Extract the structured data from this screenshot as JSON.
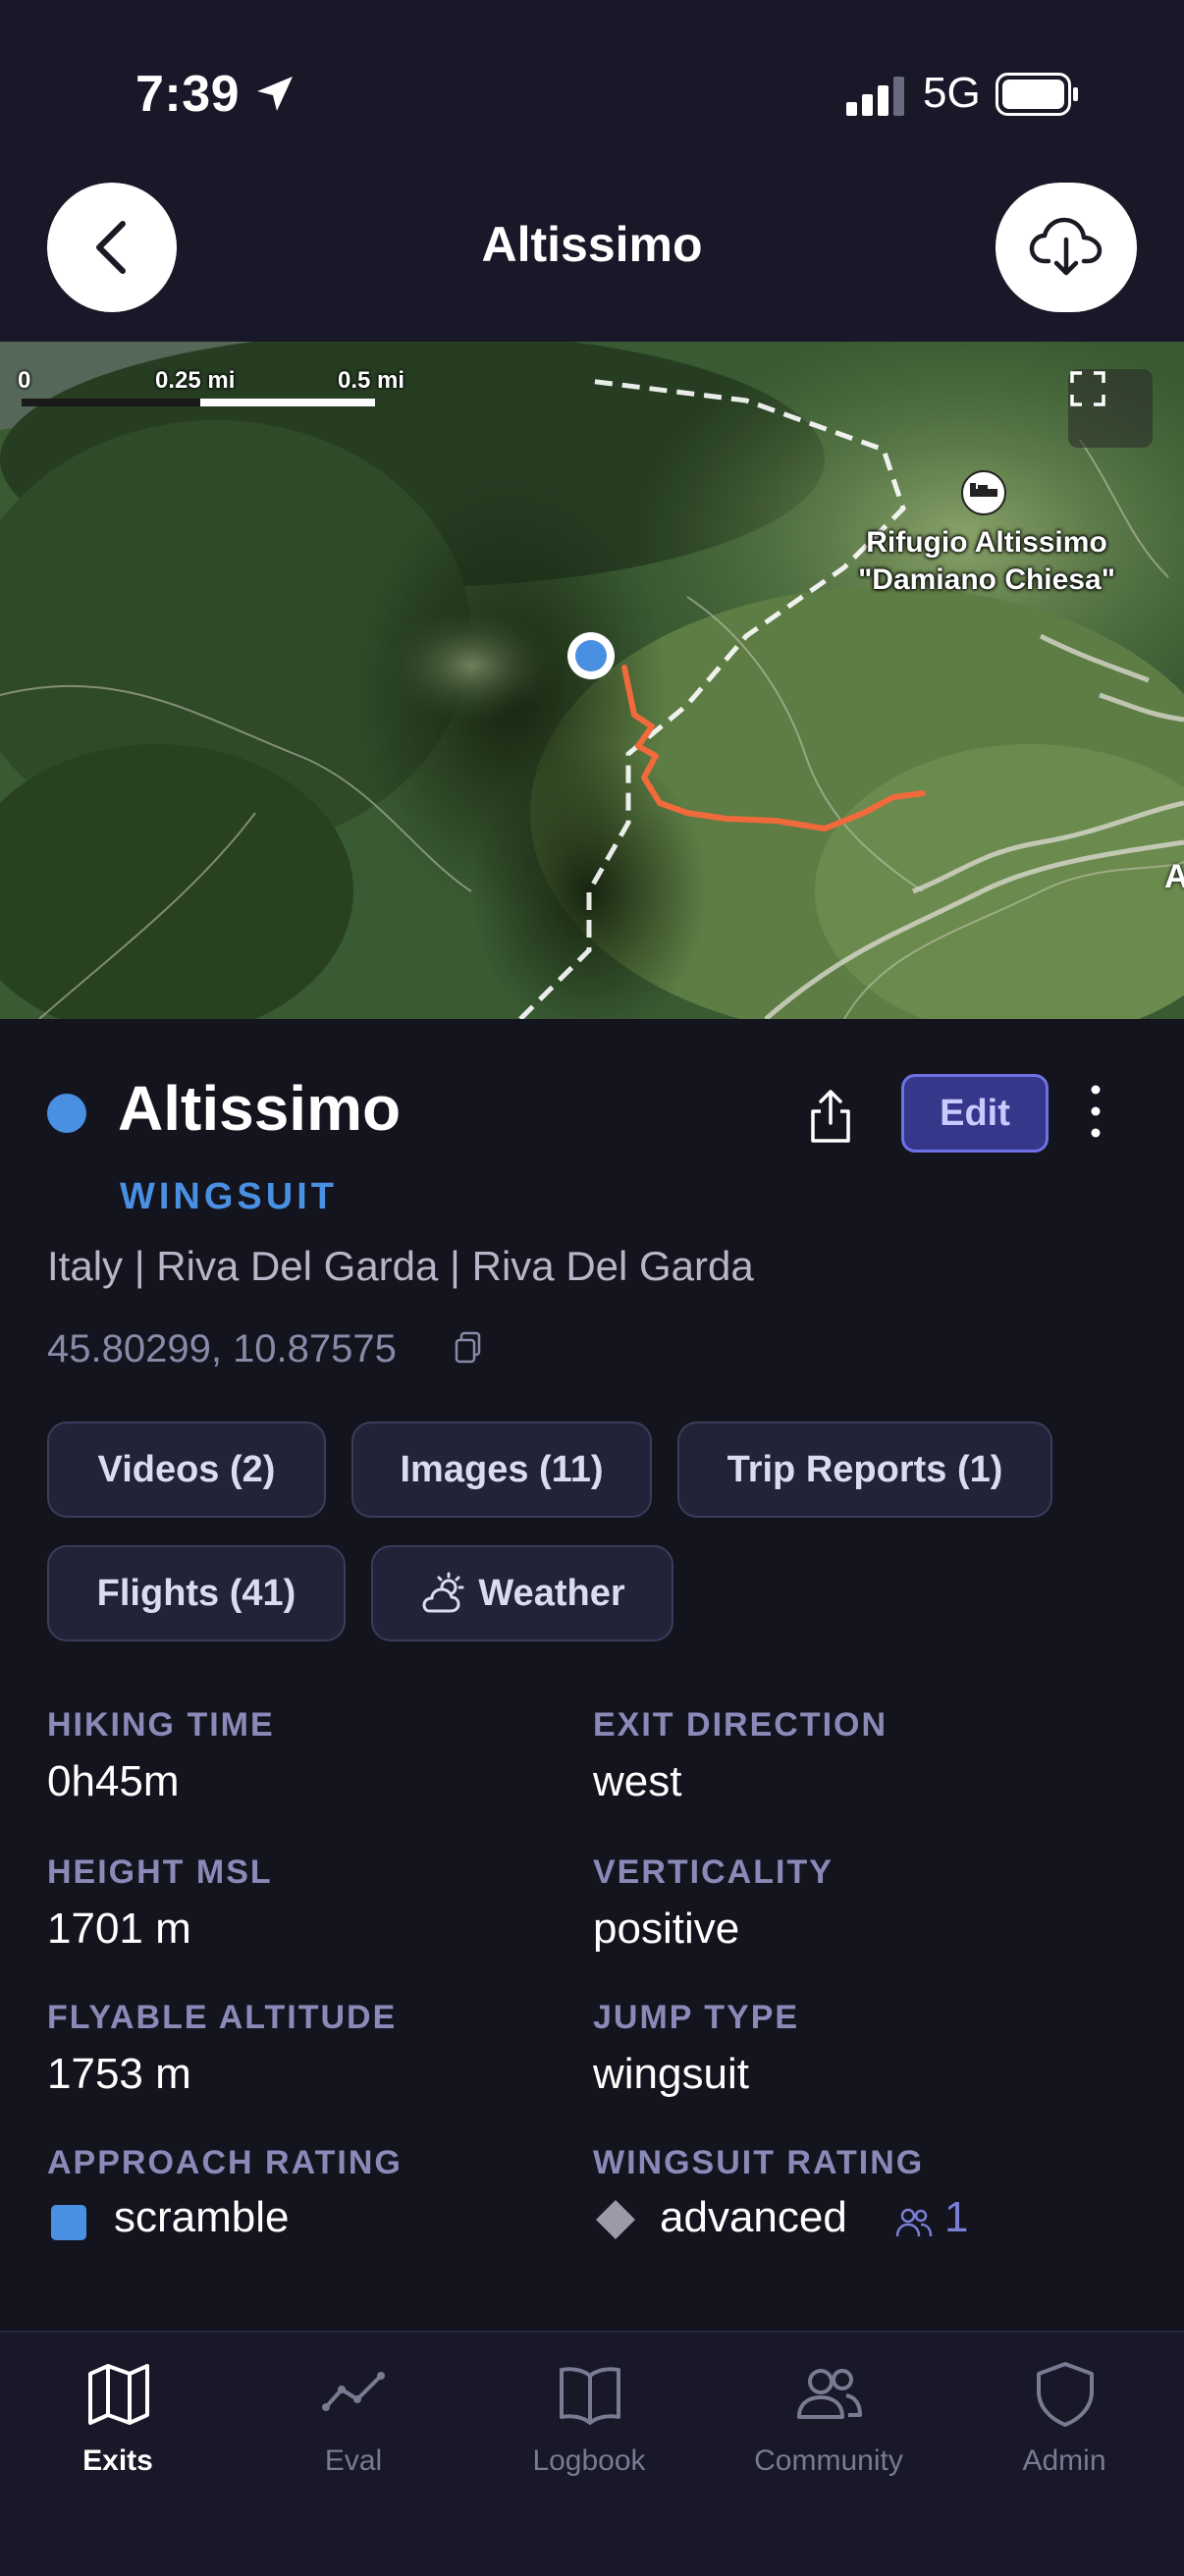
{
  "status_bar": {
    "time": "7:39",
    "network": "5G",
    "icons": [
      "location-arrow-icon",
      "signal-icon",
      "battery-icon"
    ]
  },
  "header": {
    "title": "Altissimo",
    "back_icon": "chevron-left-icon",
    "download_icon": "cloud-download-icon"
  },
  "map": {
    "scale_labels": [
      "0",
      "0.25 mi",
      "0.5 mi"
    ],
    "poi_label": "Rifugio Altissimo \"Damiano Chiesa\"",
    "poi_icon": "bed-icon",
    "edge_label": "A",
    "route_color": "#f06a3c",
    "trail_color": "#ffffff",
    "exit_marker_color": "#4a90e2",
    "fullscreen_icon": "fullscreen-icon"
  },
  "exit": {
    "name": "Altissimo",
    "category": "WINGSUIT",
    "location": "Italy | Riva Del Garda | Riva Del Garda",
    "coordinates": "45.80299, 10.87575",
    "edit_label": "Edit",
    "accent": "#4a90e2"
  },
  "chips": [
    {
      "label": "Videos (2)"
    },
    {
      "label": "Images (11)"
    },
    {
      "label": "Trip Reports (1)"
    },
    {
      "label": "Flights (41)"
    },
    {
      "label": "Weather",
      "icon": "sun-cloud-icon"
    }
  ],
  "stats": {
    "hiking_time": {
      "label": "HIKING TIME",
      "value": "0h45m"
    },
    "exit_direction": {
      "label": "EXIT DIRECTION",
      "value": "west"
    },
    "height_msl": {
      "label": "HEIGHT MSL",
      "value": "1701 m"
    },
    "verticality": {
      "label": "VERTICALITY",
      "value": "positive"
    },
    "flyable_altitude": {
      "label": "FLYABLE ALTITUDE",
      "value": "1753 m"
    },
    "jump_type": {
      "label": "JUMP TYPE",
      "value": "wingsuit"
    },
    "approach_rating": {
      "label": "APPROACH RATING",
      "value": "scramble",
      "icon": "blue-square-icon"
    },
    "wingsuit_rating": {
      "label": "WINGSUIT RATING",
      "value": "advanced",
      "icon": "gray-diamond-icon",
      "people_count": "1"
    }
  },
  "tabs": [
    {
      "label": "Exits",
      "icon": "map-icon",
      "active": true
    },
    {
      "label": "Eval",
      "icon": "chart-line-icon",
      "active": false
    },
    {
      "label": "Logbook",
      "icon": "book-icon",
      "active": false
    },
    {
      "label": "Community",
      "icon": "people-icon",
      "active": false
    },
    {
      "label": "Admin",
      "icon": "shield-icon",
      "active": false
    }
  ]
}
